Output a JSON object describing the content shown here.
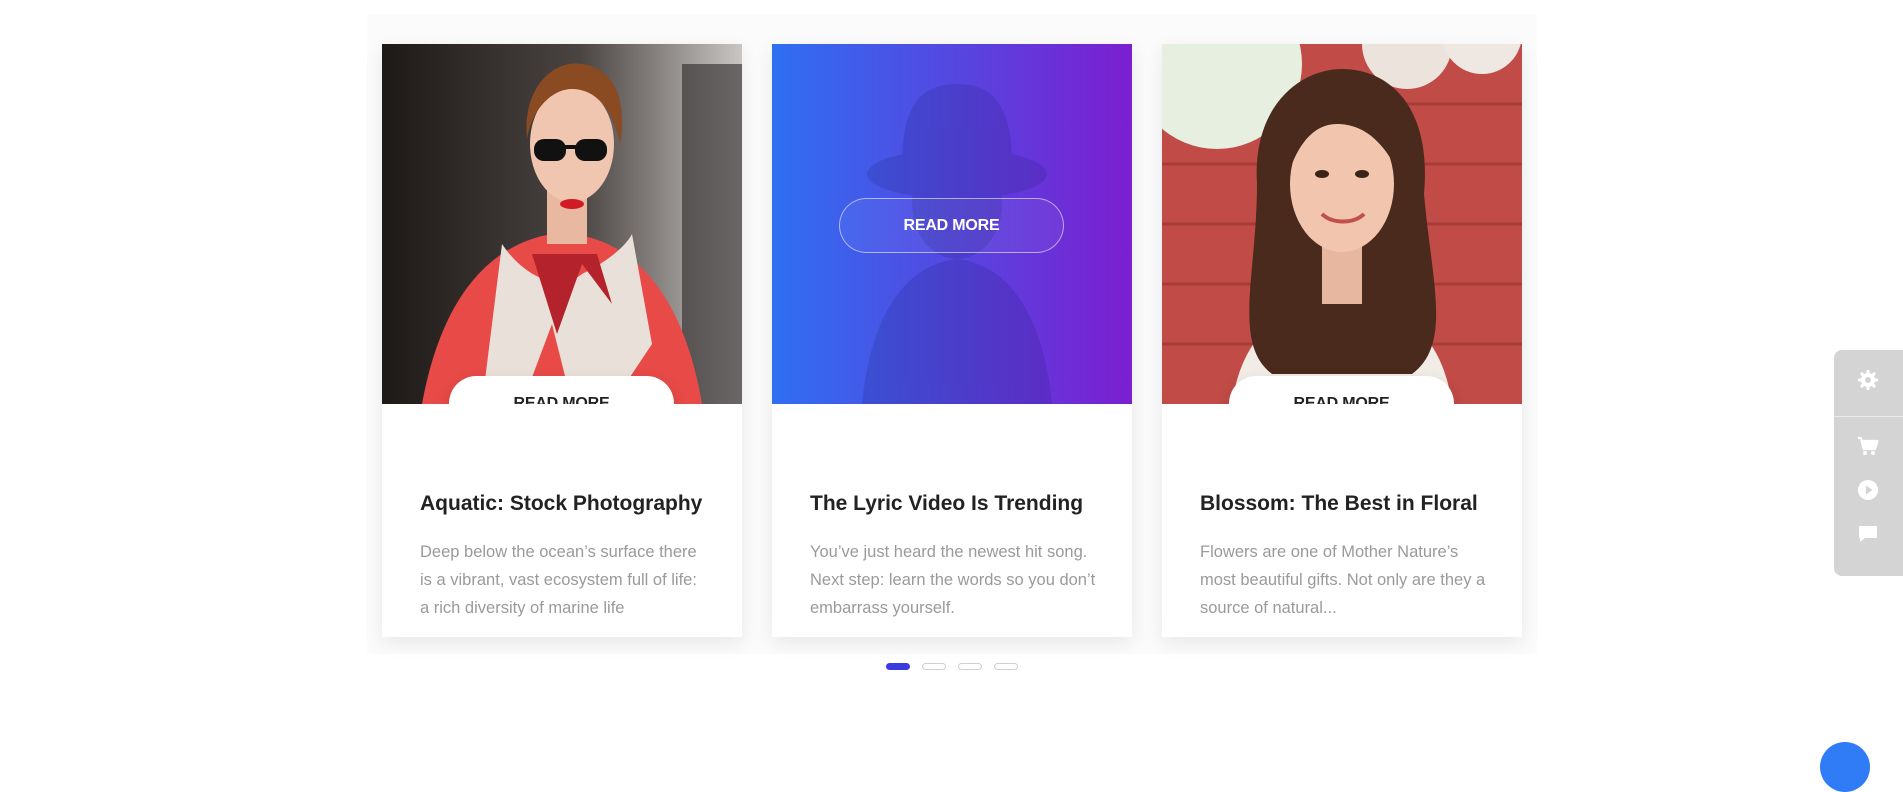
{
  "cards": [
    {
      "title": "Aquatic: Stock Photography",
      "excerpt": "Deep below the ocean’s surface there is a vibrant, vast ecosystem full of life: a rich diversity of marine life",
      "button_label": "READ MORE"
    },
    {
      "title": "The Lyric Video Is Trending",
      "excerpt": "You’ve just heard the newest hit song. Next step: learn the words so you don’t embarrass yourself.",
      "button_label": "READ MORE"
    },
    {
      "title": "Blossom: The Best in Floral",
      "excerpt": "Flowers are one of Mother Nature’s most beautiful gifts. Not only are they a source of natural...",
      "button_label": "READ MORE"
    }
  ],
  "pagination": {
    "total": 4,
    "active_index": 0
  },
  "side_panel": {
    "icons": [
      "gear-icon",
      "cart-icon",
      "play-icon",
      "chat-icon"
    ]
  },
  "colors": {
    "accent": "#3b3ce0",
    "gradient_start": "#2f6ff2",
    "gradient_end": "#7b1fd0",
    "fab": "#2f7cf6"
  }
}
